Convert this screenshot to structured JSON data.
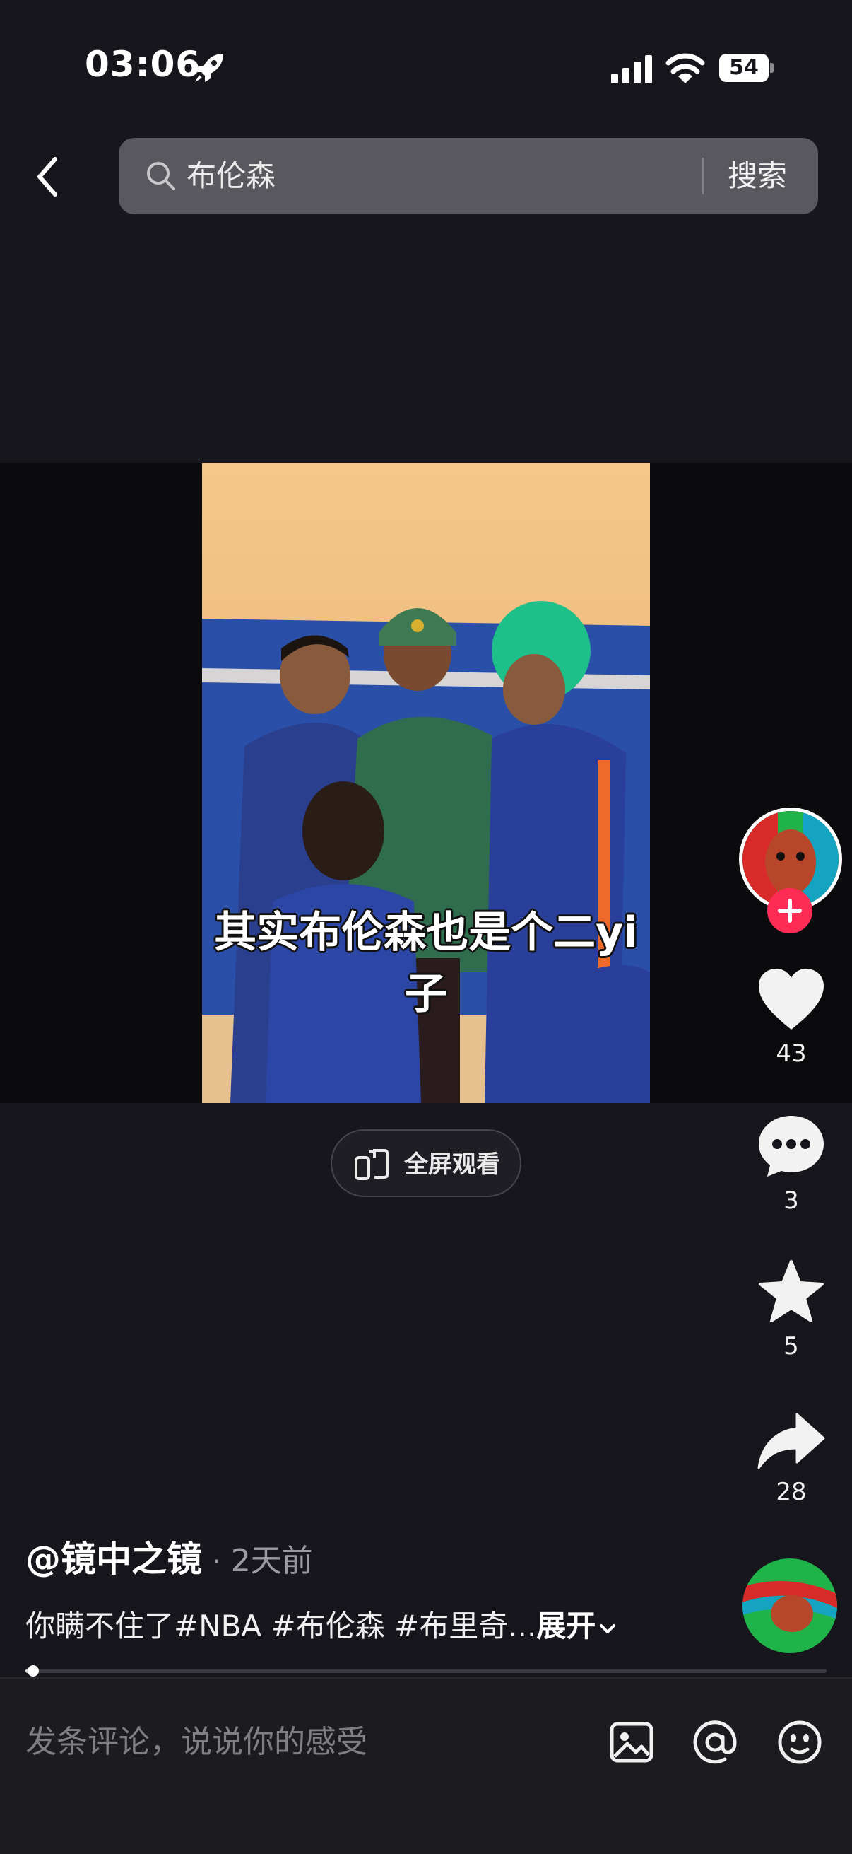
{
  "status_bar": {
    "time": "03:06",
    "battery_level": "54"
  },
  "search": {
    "query": "布伦森",
    "button_label": "搜索"
  },
  "video": {
    "caption": "其实布伦森也是个二yi子"
  },
  "fullscreen": {
    "label": "全屏观看"
  },
  "actions": {
    "likes": "43",
    "comments": "3",
    "favorites": "5",
    "shares": "28"
  },
  "post": {
    "author": "@镜中之镜",
    "separator": "·",
    "time_ago": "2天前",
    "description": "你瞒不住了#NBA #布伦森 #布里奇...",
    "expand_label": "展开"
  },
  "progress": {
    "fraction": 0.01
  },
  "comment_bar": {
    "placeholder": "发条评论，说说你的感受"
  },
  "icons": [
    "rocket-icon",
    "signal-icon",
    "wifi-icon",
    "back-chevron-icon",
    "search-icon",
    "fullscreen-icon",
    "plus-icon",
    "heart-icon",
    "comment-bubble-icon",
    "star-icon",
    "share-arrow-icon",
    "chevron-down-icon",
    "image-icon",
    "at-icon",
    "emoji-icon"
  ],
  "colors": {
    "background": "#16161c",
    "follow": "#fe2c55",
    "search_box": "#58585e"
  }
}
